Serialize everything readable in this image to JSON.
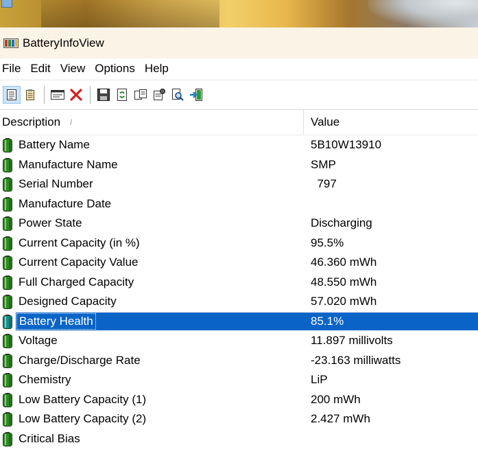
{
  "window": {
    "title": "BatteryInfoView"
  },
  "menu": [
    "File",
    "Edit",
    "View",
    "Options",
    "Help"
  ],
  "toolbar": [
    {
      "name": "html-report-icon"
    },
    {
      "name": "properties-list-icon"
    },
    {
      "sep": true
    },
    {
      "name": "window-icon"
    },
    {
      "name": "delete-x-icon"
    },
    {
      "sep": true
    },
    {
      "name": "save-icon"
    },
    {
      "name": "refresh-icon"
    },
    {
      "name": "copy-icon"
    },
    {
      "name": "properties-icon"
    },
    {
      "name": "find-icon"
    },
    {
      "name": "exit-icon"
    }
  ],
  "columns": {
    "description": "Description",
    "value": "Value",
    "sort_indicator": "/"
  },
  "rows": [
    {
      "desc": "Battery Name",
      "val": "5B10W13910"
    },
    {
      "desc": "Manufacture Name",
      "val": "SMP"
    },
    {
      "desc": "Serial Number",
      "val": "  797"
    },
    {
      "desc": "Manufacture Date",
      "val": ""
    },
    {
      "desc": "Power State",
      "val": "Discharging"
    },
    {
      "desc": "Current Capacity (in %)",
      "val": "95.5%"
    },
    {
      "desc": "Current Capacity Value",
      "val": "46.360 mWh"
    },
    {
      "desc": "Full Charged Capacity",
      "val": "48.550 mWh"
    },
    {
      "desc": "Designed Capacity",
      "val": "57.020 mWh"
    },
    {
      "desc": "Battery Health",
      "val": "85.1%",
      "selected": true
    },
    {
      "desc": "Voltage",
      "val": "11.897 millivolts"
    },
    {
      "desc": "Charge/Discharge Rate",
      "val": "-23.163 milliwatts"
    },
    {
      "desc": "Chemistry",
      "val": "LiP"
    },
    {
      "desc": "Low Battery Capacity (1)",
      "val": "200 mWh"
    },
    {
      "desc": "Low Battery Capacity (2)",
      "val": "2.427 mWh"
    },
    {
      "desc": "Critical Bias",
      "val": ""
    }
  ],
  "colors": {
    "selection": "#0a64c8",
    "battery": "#2f8a25",
    "title_bg": "#fbf3e6"
  }
}
